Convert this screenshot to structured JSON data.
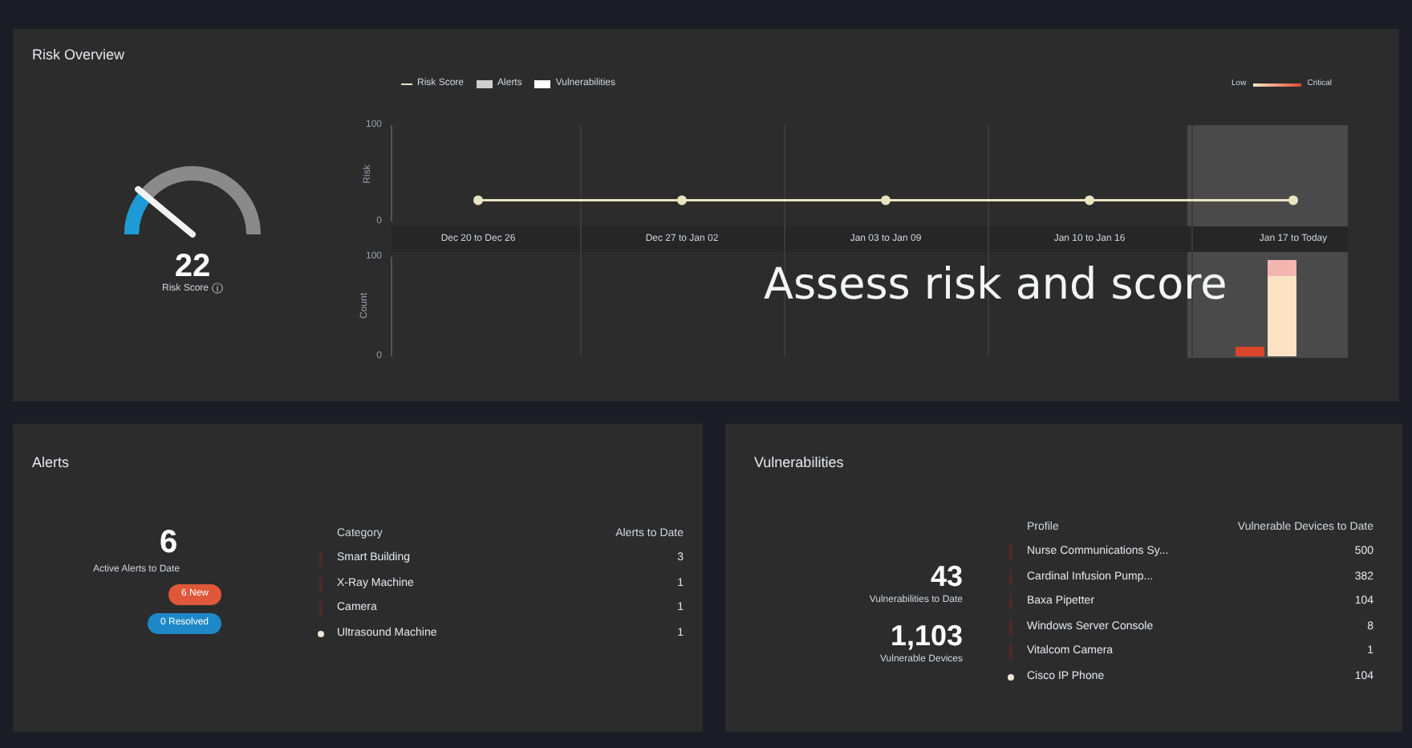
{
  "risk_overview": {
    "title": "Risk Overview",
    "gauge": {
      "value": "22",
      "label": "Risk Score",
      "info_icon": "ⓘ"
    },
    "legend": [
      {
        "label": "Alerts",
        "color": "#cfcfcf"
      },
      {
        "label": "Vulnerabilities",
        "color": "#ffffff"
      }
    ],
    "severity_scale": {
      "low": "Low",
      "high": "Critical"
    },
    "caption": "Assess risk and score",
    "chart_data": {
      "type": "line",
      "categories": [
        "Dec 20 to Dec 26",
        "Dec 27 to Jan 02",
        "Jan 03 to Jan 09",
        "Jan 10 to Jan 16",
        "Jan 17 to Today"
      ],
      "ylabel": "Risk",
      "ylim": [
        0,
        100
      ],
      "yticks": [
        0,
        100
      ],
      "series": [
        {
          "name": "Risk Score",
          "color": "#e8e4c0",
          "marker": "circle",
          "values": [
            22,
            22,
            22,
            22,
            22
          ]
        }
      ]
    },
    "count_axis": {
      "max": "100",
      "min": "0",
      "label": "Count"
    }
  },
  "alerts": {
    "title": "Alerts",
    "count": "6",
    "count_label": "Active Alerts to Date",
    "badges": [
      {
        "label": "6 New",
        "color": "#e0583a"
      },
      {
        "label": "0 Resolved",
        "color": "#1e88c8"
      }
    ],
    "columns": [
      "Category",
      "Alerts to Date"
    ],
    "rows": [
      {
        "name": "Smart Building",
        "value": "3",
        "selected": false
      },
      {
        "name": "X-Ray Machine",
        "value": "1",
        "selected": false
      },
      {
        "name": "Camera",
        "value": "1",
        "selected": false
      },
      {
        "name": "Ultrasound Machine",
        "value": "1",
        "selected": true
      }
    ]
  },
  "vulnerabilities": {
    "title": "Vulnerabilities",
    "stats": [
      {
        "value": "43",
        "label": "Vulnerabilities to Date"
      },
      {
        "value": "1,103",
        "label": "Vulnerable Devices"
      }
    ],
    "columns": [
      "Profile",
      "Vulnerable Devices to Date"
    ],
    "rows": [
      {
        "name": "Nurse Communications Sy...",
        "value": "500",
        "selected": false
      },
      {
        "name": "Cardinal Infusion Pump...",
        "value": "382",
        "selected": false
      },
      {
        "name": "Baxa Pipetter",
        "value": "104",
        "selected": false
      },
      {
        "name": "Windows Server Console",
        "value": "8",
        "selected": false
      },
      {
        "name": "Vitalcom Camera",
        "value": "1",
        "selected": false
      },
      {
        "name": "Cisco IP Phone",
        "value": "104",
        "selected": true
      }
    ]
  }
}
